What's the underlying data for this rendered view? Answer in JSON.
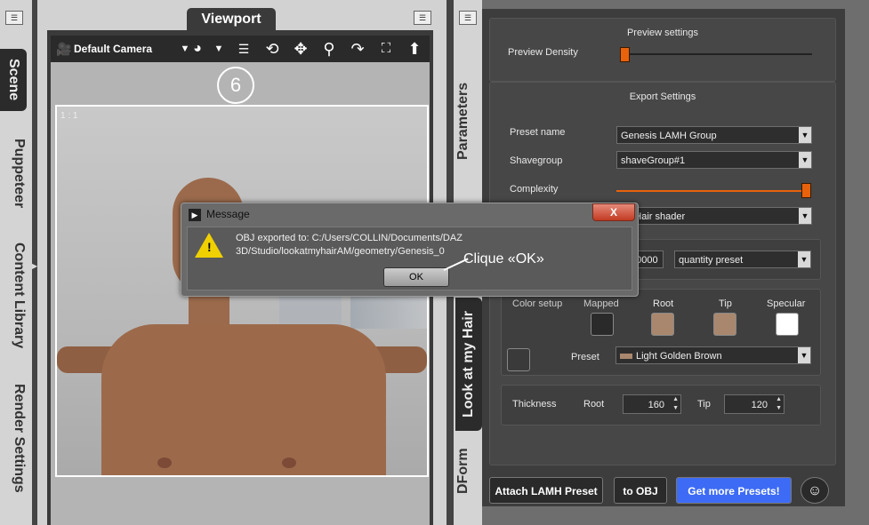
{
  "left_tabs": [
    "Scene",
    "Puppeteer",
    "Content Library",
    "Render Settings"
  ],
  "viewport": {
    "tab_label": "Viewport",
    "camera": "Default Camera",
    "step_number": "6",
    "ratio": "1 : 1"
  },
  "right_tabs": [
    "Parameters",
    "Look at my Hair",
    "DForm"
  ],
  "preview": {
    "title": "Preview settings",
    "density_label": "Preview Density",
    "density_level": 0.02
  },
  "export": {
    "title": "Export Settings",
    "preset_name_label": "Preset name",
    "preset_name_value": "Genesis LAMH Group",
    "shavegroup_label": "Shavegroup",
    "shavegroup_value": "shaveGroup#1",
    "complexity_label": "Complexity",
    "complexity_level": 1.0,
    "shader_value": "an Hair shader",
    "quantity_value": "20000",
    "quantity_preset": "quantity preset"
  },
  "color_setup": {
    "title": "Color setup",
    "mapped_label": "Mapped",
    "root_label": "Root",
    "tip_label": "Tip",
    "specular_label": "Specular",
    "preset_label": "Preset",
    "preset_value": "Light Golden Brown",
    "colors": {
      "mapped": "#2a2a2a",
      "root": "#a9876e",
      "tip": "#a9876e",
      "specular": "#ffffff",
      "preset_chip": "#a9876e"
    }
  },
  "thickness": {
    "label": "Thickness",
    "root_label": "Root",
    "root_value": "160",
    "tip_label": "Tip",
    "tip_value": "120"
  },
  "buttons": {
    "attach": "Attach LAMH Preset",
    "to_obj": "to OBJ",
    "get_more": "Get more Presets!"
  },
  "dialog": {
    "title": "Message",
    "close": "X",
    "message_line1": "OBJ exported to: C:/Users/COLLIN/Documents/DAZ",
    "message_line2": "3D/Studio/lookatmyhairAM/geometry/Genesis_0",
    "ok": "OK",
    "annotation": "Clique «OK»"
  },
  "colors": {
    "accent_blue": "#3d6bf5",
    "slider_orange": "#e8620c"
  }
}
